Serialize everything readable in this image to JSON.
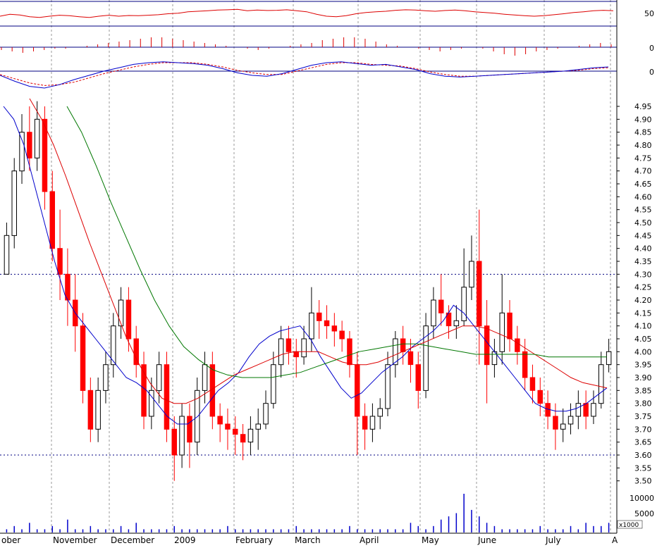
{
  "chart_data": {
    "type": "candlestick",
    "title": "",
    "x_months": [
      "ober",
      "November",
      "December",
      "2009",
      "February",
      "March",
      "April",
      "May",
      "June",
      "July",
      "A"
    ],
    "price_axis": {
      "ticks": [
        "3.50",
        "3.55",
        "3.60",
        "3.65",
        "3.70",
        "3.75",
        "3.80",
        "3.85",
        "3.90",
        "3.95",
        "4.00",
        "4.05",
        "4.10",
        "4.15",
        "4.20",
        "4.25",
        "4.30",
        "4.35",
        "4.40",
        "4.45",
        "4.50",
        "4.55",
        "4.60",
        "4.65",
        "4.70",
        "4.75",
        "4.80",
        "4.85",
        "4.90",
        "4.95"
      ],
      "range": [
        3.48,
        4.98
      ],
      "reference_lines": [
        4.3,
        3.6
      ]
    },
    "volume_axis": {
      "ticks": [
        "5000",
        "10000"
      ],
      "unit": "x1000"
    },
    "rsi_panel": {
      "tick": "50"
    },
    "histogram_panel": {
      "tick": "0"
    },
    "macd_panel": {
      "tick": "0"
    },
    "colors": {
      "up": "#000000",
      "down": "#ff0000",
      "ma_short": "#0000cc",
      "ma_mid": "#dd0000",
      "ma_long": "#007700",
      "grid": "#999999",
      "panel_line": "#000080"
    },
    "candles": [
      [
        4.3,
        4.45,
        4.3,
        4.5
      ],
      [
        4.45,
        4.7,
        4.4,
        4.75
      ],
      [
        4.7,
        4.85,
        4.65,
        4.92
      ],
      [
        4.85,
        4.75,
        4.7,
        4.95
      ],
      [
        4.75,
        4.9,
        4.7,
        4.97
      ],
      [
        4.9,
        4.62,
        4.55,
        4.95
      ],
      [
        4.62,
        4.4,
        4.35,
        4.7
      ],
      [
        4.4,
        4.3,
        4.2,
        4.55
      ],
      [
        4.3,
        4.2,
        4.1,
        4.4
      ],
      [
        4.2,
        4.1,
        4.0,
        4.3
      ],
      [
        4.1,
        3.85,
        3.8,
        4.15
      ],
      [
        3.85,
        3.7,
        3.65,
        3.9
      ],
      [
        3.7,
        3.85,
        3.65,
        3.9
      ],
      [
        3.85,
        3.95,
        3.8,
        4.0
      ],
      [
        3.95,
        4.1,
        3.9,
        4.15
      ],
      [
        4.1,
        4.2,
        4.05,
        4.25
      ],
      [
        4.2,
        4.05,
        4.0,
        4.25
      ],
      [
        4.05,
        3.95,
        3.9,
        4.1
      ],
      [
        3.95,
        3.75,
        3.7,
        4.0
      ],
      [
        3.75,
        3.85,
        3.7,
        3.9
      ],
      [
        3.85,
        3.95,
        3.8,
        4.0
      ],
      [
        3.95,
        3.7,
        3.65,
        4.0
      ],
      [
        3.7,
        3.6,
        3.5,
        3.75
      ],
      [
        3.6,
        3.75,
        3.55,
        3.8
      ],
      [
        3.75,
        3.65,
        3.55,
        3.8
      ],
      [
        3.65,
        3.85,
        3.6,
        3.9
      ],
      [
        3.85,
        3.95,
        3.8,
        4.0
      ],
      [
        3.95,
        3.75,
        3.7,
        4.0
      ],
      [
        3.75,
        3.72,
        3.65,
        3.8
      ],
      [
        3.72,
        3.7,
        3.62,
        3.78
      ],
      [
        3.7,
        3.68,
        3.6,
        3.75
      ],
      [
        3.68,
        3.65,
        3.58,
        3.72
      ],
      [
        3.65,
        3.7,
        3.6,
        3.75
      ],
      [
        3.7,
        3.72,
        3.62,
        3.78
      ],
      [
        3.72,
        3.8,
        3.7,
        3.85
      ],
      [
        3.8,
        3.95,
        3.78,
        4.0
      ],
      [
        3.95,
        4.05,
        3.9,
        4.1
      ],
      [
        4.05,
        4.0,
        3.95,
        4.1
      ],
      [
        4.0,
        3.98,
        3.9,
        4.05
      ],
      [
        3.98,
        4.05,
        3.95,
        4.1
      ],
      [
        4.05,
        4.15,
        4.0,
        4.25
      ],
      [
        4.15,
        4.12,
        4.05,
        4.2
      ],
      [
        4.12,
        4.1,
        4.05,
        4.18
      ],
      [
        4.1,
        4.08,
        4.02,
        4.15
      ],
      [
        4.08,
        4.05,
        4.0,
        4.12
      ],
      [
        4.05,
        3.95,
        3.9,
        4.08
      ],
      [
        3.95,
        3.75,
        3.6,
        4.0
      ],
      [
        3.75,
        3.7,
        3.62,
        3.8
      ],
      [
        3.7,
        3.75,
        3.65,
        3.8
      ],
      [
        3.75,
        3.78,
        3.7,
        3.82
      ],
      [
        3.78,
        3.95,
        3.75,
        4.0
      ],
      [
        3.95,
        4.05,
        3.9,
        4.08
      ],
      [
        4.05,
        4.0,
        3.95,
        4.1
      ],
      [
        4.0,
        3.95,
        3.88,
        4.05
      ],
      [
        3.95,
        3.85,
        3.78,
        4.0
      ],
      [
        3.85,
        4.1,
        3.82,
        4.15
      ],
      [
        4.1,
        4.2,
        4.05,
        4.25
      ],
      [
        4.2,
        4.15,
        4.1,
        4.3
      ],
      [
        4.15,
        4.1,
        4.05,
        4.18
      ],
      [
        4.1,
        4.12,
        4.05,
        4.18
      ],
      [
        4.12,
        4.25,
        4.1,
        4.4
      ],
      [
        4.25,
        4.35,
        4.2,
        4.45
      ],
      [
        4.35,
        4.1,
        3.95,
        4.55
      ],
      [
        4.1,
        3.95,
        3.8,
        4.2
      ],
      [
        3.95,
        4.0,
        3.9,
        4.05
      ],
      [
        4.0,
        4.15,
        3.95,
        4.3
      ],
      [
        4.15,
        4.05,
        4.0,
        4.2
      ],
      [
        4.05,
        4.0,
        3.95,
        4.1
      ],
      [
        4.0,
        3.9,
        3.85,
        4.05
      ],
      [
        3.9,
        3.85,
        3.8,
        3.95
      ],
      [
        3.85,
        3.8,
        3.75,
        3.9
      ],
      [
        3.8,
        3.75,
        3.7,
        3.85
      ],
      [
        3.75,
        3.7,
        3.62,
        3.8
      ],
      [
        3.7,
        3.72,
        3.65,
        3.78
      ],
      [
        3.72,
        3.75,
        3.68,
        3.8
      ],
      [
        3.75,
        3.8,
        3.7,
        3.85
      ],
      [
        3.8,
        3.75,
        3.7,
        3.85
      ],
      [
        3.75,
        3.8,
        3.72,
        3.85
      ],
      [
        3.8,
        3.95,
        3.78,
        4.0
      ],
      [
        3.95,
        4.0,
        3.92,
        4.05
      ]
    ],
    "ma_short": [
      4.95,
      4.9,
      4.8,
      4.65,
      4.5,
      4.35,
      4.22,
      4.15,
      4.1,
      4.05,
      4.0,
      3.95,
      3.9,
      3.88,
      3.85,
      3.8,
      3.75,
      3.72,
      3.72,
      3.75,
      3.8,
      3.85,
      3.88,
      3.92,
      3.98,
      4.03,
      4.06,
      4.08,
      4.09,
      4.1,
      4.05,
      3.98,
      3.92,
      3.86,
      3.82,
      3.84,
      3.88,
      3.92,
      3.95,
      3.98,
      4.02,
      4.05,
      4.08,
      4.12,
      4.18,
      4.15,
      4.1,
      4.05,
      4.0,
      3.95,
      3.9,
      3.85,
      3.8,
      3.78,
      3.77,
      3.77,
      3.78,
      3.8,
      3.83,
      3.86
    ],
    "ma_mid": [
      4.98,
      4.9,
      4.8,
      4.68,
      4.55,
      4.42,
      4.3,
      4.18,
      4.06,
      3.96,
      3.88,
      3.82,
      3.8,
      3.8,
      3.82,
      3.85,
      3.88,
      3.91,
      3.93,
      3.95,
      3.97,
      3.99,
      4.0,
      4.0,
      4.0,
      3.98,
      3.96,
      3.95,
      3.95,
      3.96,
      3.98,
      4.0,
      4.02,
      4.04,
      4.06,
      4.08,
      4.1,
      4.1,
      4.09,
      4.07,
      4.05,
      4.02,
      3.99,
      3.96,
      3.93,
      3.9,
      3.88,
      3.87,
      3.86
    ],
    "ma_long": [
      4.95,
      4.85,
      4.72,
      4.58,
      4.45,
      4.32,
      4.2,
      4.1,
      4.02,
      3.97,
      3.93,
      3.91,
      3.9,
      3.9,
      3.9,
      3.91,
      3.92,
      3.94,
      3.96,
      3.98,
      4.0,
      4.01,
      4.02,
      4.03,
      4.03,
      4.02,
      4.01,
      4.0,
      3.99,
      3.99,
      3.99,
      3.99,
      3.99,
      3.98,
      3.98,
      3.98,
      3.98,
      3.98
    ],
    "volume": [
      1,
      2,
      1,
      3,
      1,
      1,
      2,
      1,
      4,
      1,
      1,
      2,
      1,
      1,
      1,
      2,
      1,
      3,
      1,
      1,
      1,
      1,
      2,
      1,
      1,
      1,
      1,
      1,
      1,
      2,
      1,
      1,
      1,
      1,
      1,
      1,
      1,
      1,
      2,
      1,
      1,
      1,
      1,
      1,
      1,
      2,
      1,
      1,
      1,
      1,
      1,
      1,
      1,
      3,
      2,
      1,
      2,
      4,
      5,
      6,
      12,
      7,
      5,
      3,
      2,
      1,
      1,
      1,
      1,
      1,
      2,
      1,
      1,
      1,
      2,
      1,
      3,
      2,
      2,
      3
    ],
    "rsi": [
      40,
      48,
      45,
      38,
      35,
      40,
      44,
      42,
      38,
      35,
      40,
      44,
      40,
      43,
      42,
      44,
      46,
      50,
      52,
      58,
      60,
      62,
      65,
      66,
      68,
      62,
      65,
      63,
      64,
      66,
      62,
      58,
      48,
      40,
      38,
      42,
      50,
      55,
      58,
      60,
      64,
      66,
      65,
      62,
      60,
      63,
      65,
      62,
      58,
      55,
      52,
      48,
      45,
      42,
      40,
      42,
      46,
      50,
      55,
      58,
      62,
      64,
      62
    ],
    "histogram": [
      -2,
      -3,
      -4,
      -3,
      -2,
      -1,
      -1,
      0,
      1,
      2,
      3,
      4,
      5,
      6,
      7,
      7,
      6,
      5,
      4,
      3,
      2,
      1,
      0,
      -1,
      -2,
      -1,
      0,
      1,
      2,
      3,
      5,
      6,
      7,
      7,
      6,
      4,
      2,
      1,
      0,
      -1,
      -2,
      -3,
      -2,
      -1,
      0,
      -1,
      -3,
      -5,
      -6,
      -5,
      -3,
      -2,
      -1,
      0,
      1,
      2,
      3,
      2
    ],
    "macd_line": [
      -0.05,
      -0.12,
      -0.18,
      -0.2,
      -0.16,
      -0.1,
      -0.05,
      0.0,
      0.04,
      0.08,
      0.1,
      0.11,
      0.1,
      0.09,
      0.07,
      0.03,
      -0.02,
      -0.05,
      -0.06,
      -0.03,
      0.02,
      0.07,
      0.1,
      0.11,
      0.09,
      0.07,
      0.08,
      0.05,
      0.02,
      -0.03,
      -0.06,
      -0.07,
      -0.06,
      -0.05,
      -0.04,
      -0.03,
      -0.02,
      -0.01,
      0.0,
      0.02,
      0.04,
      0.05
    ],
    "signal_line": [
      -0.04,
      -0.09,
      -0.14,
      -0.17,
      -0.16,
      -0.13,
      -0.08,
      -0.03,
      0.01,
      0.05,
      0.08,
      0.1,
      0.1,
      0.1,
      0.08,
      0.05,
      0.01,
      -0.02,
      -0.04,
      -0.04,
      0.0,
      0.04,
      0.08,
      0.1,
      0.1,
      0.08,
      0.07,
      0.06,
      0.03,
      -0.01,
      -0.04,
      -0.06,
      -0.06,
      -0.05,
      -0.04,
      -0.03,
      -0.02,
      -0.01,
      0.0,
      0.01,
      0.03,
      0.04
    ]
  }
}
